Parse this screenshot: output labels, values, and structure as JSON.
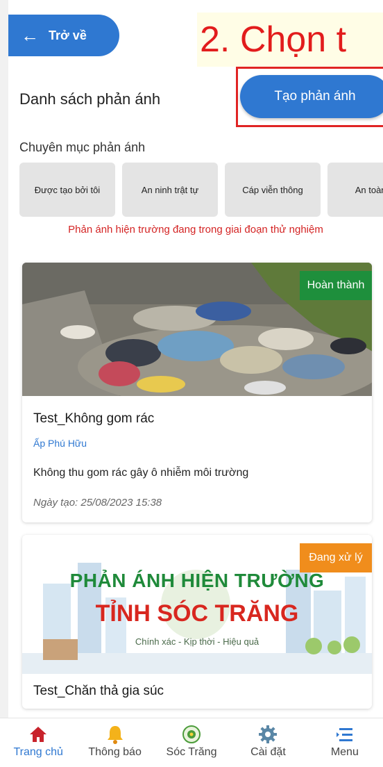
{
  "header": {
    "back_label": "Trở về",
    "instruction_text": "2. Chọn t"
  },
  "list": {
    "title": "Danh sách phản ánh",
    "create_button": "Tạo phản ánh"
  },
  "categories": {
    "heading": "Chuyên mục phản ánh",
    "items": [
      "Được tạo bởi tôi",
      "An ninh trật tự",
      "Cáp viễn thông",
      "An toàn gi"
    ]
  },
  "notice": "Phản ánh hiện trường đang trong giai đoạn thử nghiệm",
  "reports": [
    {
      "status": "Hoàn thành",
      "title": "Test_Không gom rác",
      "hamlet": "Ấp Phú Hữu",
      "description": "Không thu gom rác gây ô nhiễm môi trường",
      "date": "Ngày tạo: 25/08/2023 15:38"
    },
    {
      "status": "Đang xử lý",
      "banner_line1": "PHẢN ÁNH HIỆN TRƯỜNG",
      "banner_line2": "TỈNH SÓC TRĂNG",
      "banner_slogan": "Chính xác - Kịp thời - Hiệu quả",
      "title": "Test_Chăn thả gia súc"
    }
  ],
  "bottom_nav": [
    {
      "label": "Trang chủ",
      "icon": "home-icon"
    },
    {
      "label": "Thông báo",
      "icon": "bell-icon"
    },
    {
      "label": "Sóc Trăng",
      "icon": "province-logo-icon"
    },
    {
      "label": "Cài đặt",
      "icon": "gear-icon"
    },
    {
      "label": "Menu",
      "icon": "menu-icon"
    }
  ],
  "colors": {
    "primary": "#2f78d1",
    "done": "#1e8f3c",
    "in_progress": "#f08d1c",
    "alert": "#d42424"
  }
}
